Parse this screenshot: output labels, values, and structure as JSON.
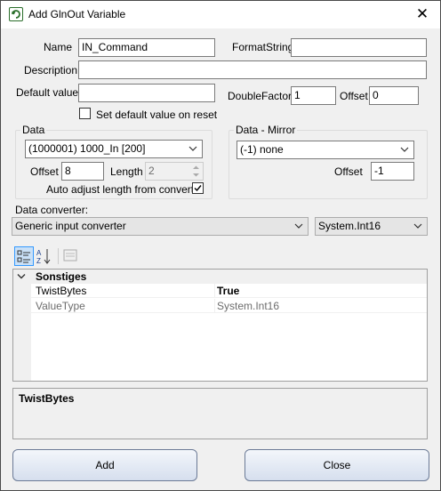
{
  "window": {
    "title": "Add GlnOut Variable",
    "icon": "app-arrow-icon",
    "close_glyph": "✕"
  },
  "fields": {
    "name_label": "Name",
    "name_value": "IN_Command",
    "format_label": "FormatString",
    "format_value": "",
    "description_label": "Description",
    "description_value": "",
    "default_label": "Default value",
    "default_value": "",
    "double_factor_label": "DoubleFactor",
    "double_factor_value": "1",
    "offset_label": "Offset",
    "offset_value": "0",
    "set_default_label": "Set default value on reset",
    "set_default_checked": false
  },
  "data_group": {
    "title": "Data",
    "selected": "(1000001) 1000_In [200]",
    "offset_label": "Offset",
    "offset_value": "8",
    "length_label": "Length",
    "length_value": "2",
    "auto_adjust_label": "Auto adjust length from converter",
    "auto_adjust_checked": true
  },
  "mirror_group": {
    "title": "Data - Mirror",
    "selected": "(-1) none",
    "offset_label": "Offset",
    "offset_value": "-1"
  },
  "converter": {
    "label": "Data converter:",
    "selected": "Generic input converter",
    "type_selected": "System.Int16"
  },
  "property_grid": {
    "category": "Sonstiges",
    "rows": [
      {
        "name": "TwistBytes",
        "value": "True",
        "bold": true,
        "readonly": false
      },
      {
        "name": "ValueType",
        "value": "System.Int16",
        "bold": false,
        "readonly": true
      }
    ],
    "help_title": "TwistBytes"
  },
  "buttons": {
    "add": "Add",
    "close": "Close"
  },
  "colors": {
    "accent": "#3399ff",
    "selected_tool": "#c9e0f7",
    "readonly_text": "#6d6d6d"
  }
}
